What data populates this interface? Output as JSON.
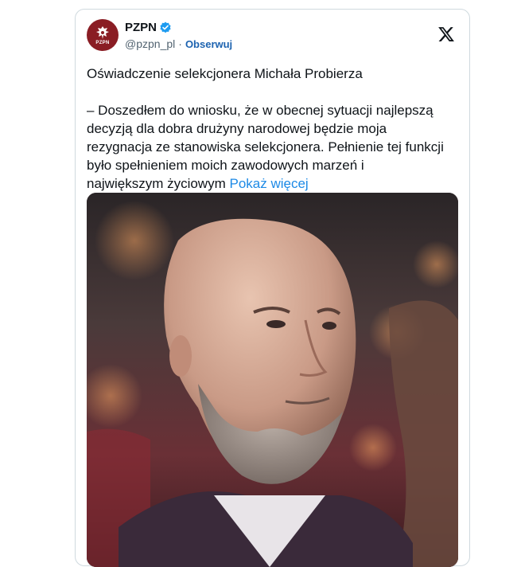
{
  "tweet": {
    "account_name": "PZPN",
    "handle": "@pzpn_pl",
    "separator": "·",
    "follow_label": "Obserwuj",
    "avatar_text": "PZPN",
    "title": "Oświadczenie selekcjonera Michała Probierza",
    "body_lines": [
      "– Doszedłem do wniosku, że w obecnej sytuacji najlepszą",
      "decyzją dla dobra drużyny narodowej będzie moja",
      "rezygnacja ze stanowiska selekcjonera. Pełnienie tej funkcji",
      "było spełnieniem moich zawodowych marzeń i",
      "największym życiowym"
    ],
    "show_more_label": "Pokaż więcej"
  },
  "colors": {
    "avatar_bg": "#8a1d24",
    "verified": "#1d9bf0",
    "link": "#1d8ae6",
    "follow": "#1d63b0"
  },
  "icons": {
    "verified": "verified-badge-icon",
    "logo": "x-logo-icon",
    "avatar": "pzpn-eagle-logo"
  }
}
